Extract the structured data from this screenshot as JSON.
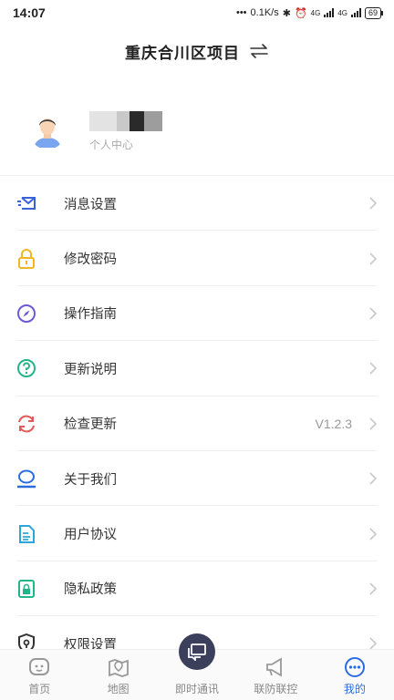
{
  "status_bar": {
    "time": "14:07",
    "network_speed": "0.1K/s",
    "signal_1_label": "4G",
    "signal_2_label": "4G",
    "battery": "69"
  },
  "header": {
    "title": "重庆合川区项目",
    "switch_icon": "switch-arrows-icon"
  },
  "profile": {
    "subtitle": "个人中心"
  },
  "menu": [
    {
      "label": "消息设置",
      "icon": "message-settings-icon",
      "color": "#3a63d8",
      "value": ""
    },
    {
      "label": "修改密码",
      "icon": "lock-icon",
      "color": "#f2b524",
      "value": ""
    },
    {
      "label": "操作指南",
      "icon": "compass-icon",
      "color": "#6b5ad6",
      "value": ""
    },
    {
      "label": "更新说明",
      "icon": "question-circle-icon",
      "color": "#23b48a",
      "value": ""
    },
    {
      "label": "检查更新",
      "icon": "refresh-icon",
      "color": "#e35a5a",
      "value": "V1.2.3"
    },
    {
      "label": "关于我们",
      "icon": "user-outline-icon",
      "color": "#2b6de0",
      "value": ""
    },
    {
      "label": "用户协议",
      "icon": "document-icon",
      "color": "#2ea7d8",
      "value": ""
    },
    {
      "label": "隐私政策",
      "icon": "privacy-icon",
      "color": "#23b48a",
      "value": ""
    },
    {
      "label": "权限设置",
      "icon": "permission-shield-icon",
      "color": "#333333",
      "value": ""
    }
  ],
  "bottom_nav": [
    {
      "label": "首页",
      "icon": "home-face-icon"
    },
    {
      "label": "地图",
      "icon": "map-pin-icon"
    },
    {
      "label": "即时通讯",
      "icon": "chat-icon"
    },
    {
      "label": "联防联控",
      "icon": "megaphone-icon"
    },
    {
      "label": "我的",
      "icon": "more-dots-icon",
      "active": true
    }
  ],
  "colors": {
    "accent": "#2b6de0",
    "center_button": "#3b3f5c"
  }
}
